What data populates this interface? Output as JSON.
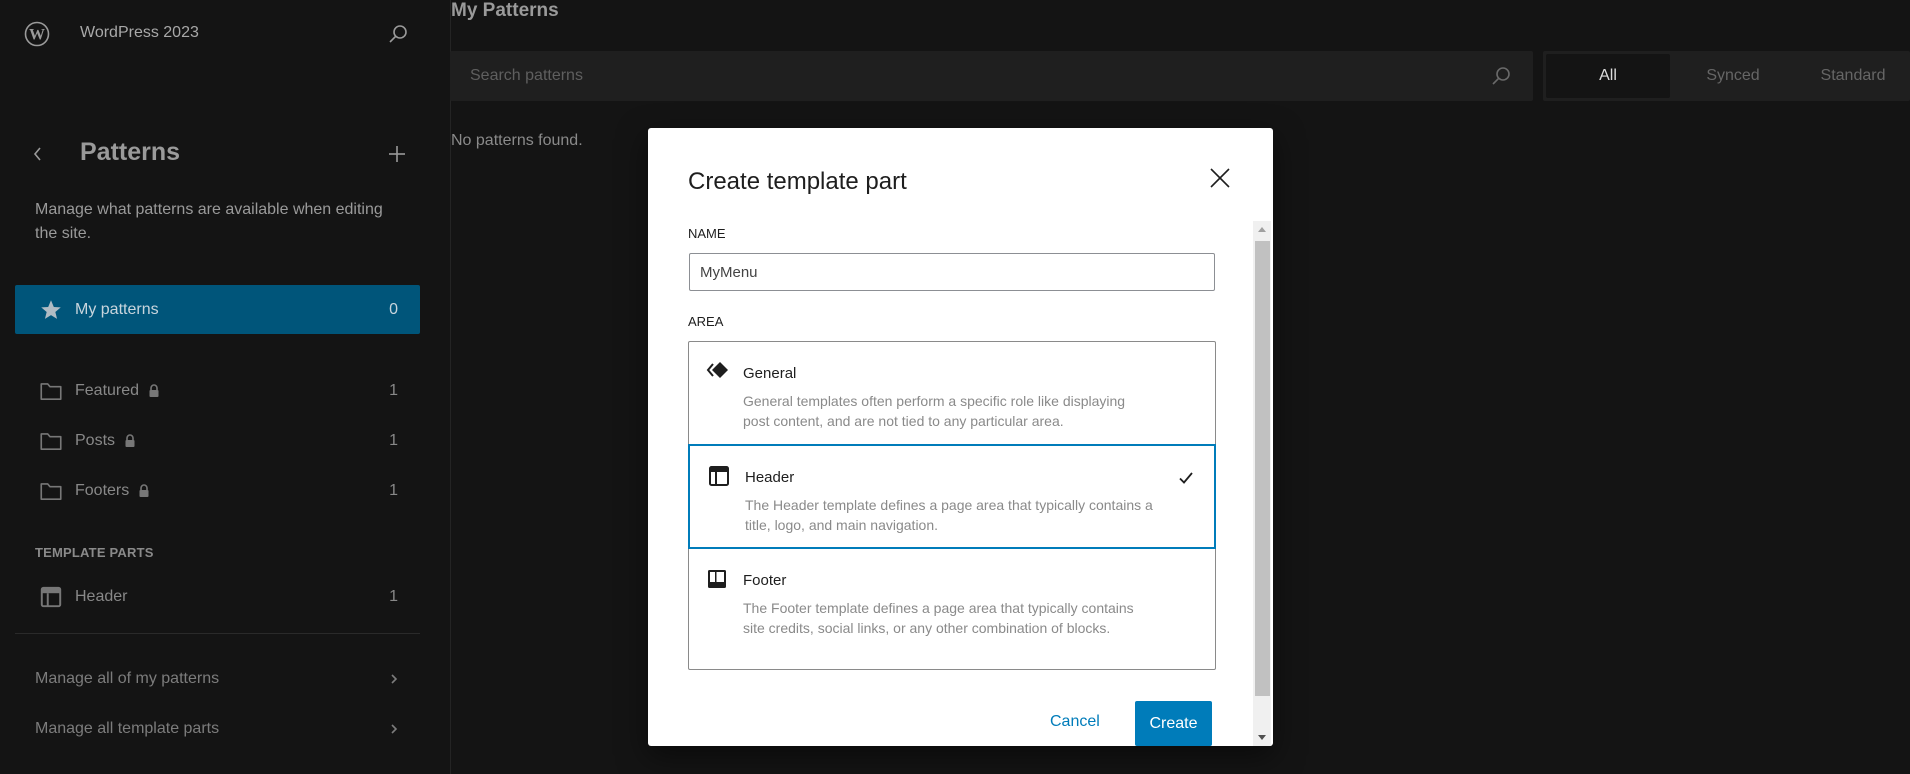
{
  "site": {
    "title": "WordPress 2023"
  },
  "sidebar": {
    "title": "Patterns",
    "description": "Manage what patterns are available when editing the site.",
    "items": [
      {
        "label": "My patterns",
        "count": "0",
        "icon": "star-icon",
        "active": true
      },
      {
        "label": "Featured",
        "count": "1",
        "icon": "folder-icon",
        "locked": true
      },
      {
        "label": "Posts",
        "count": "1",
        "icon": "folder-icon",
        "locked": true
      },
      {
        "label": "Footers",
        "count": "1",
        "icon": "folder-icon",
        "locked": true
      }
    ],
    "template_parts_heading": "TEMPLATE PARTS",
    "template_parts": [
      {
        "label": "Header",
        "count": "1",
        "icon": "header-layout-icon"
      }
    ],
    "links": [
      {
        "label": "Manage all of my patterns"
      },
      {
        "label": "Manage all template parts"
      }
    ]
  },
  "main": {
    "title": "My Patterns",
    "search_placeholder": "Search patterns",
    "filters": [
      {
        "label": "All",
        "active": true
      },
      {
        "label": "Synced"
      },
      {
        "label": "Standard"
      }
    ],
    "empty_message": "No patterns found."
  },
  "modal": {
    "title": "Create template part",
    "name_label": "NAME",
    "name_value": "MyMenu",
    "area_label": "AREA",
    "areas": [
      {
        "name": "General",
        "description": "General templates often perform a specific role like displaying post content, and are not tied to any particular area.",
        "selected": false
      },
      {
        "name": "Header",
        "description": "The Header template defines a page area that typically contains a title, logo, and main navigation.",
        "selected": true
      },
      {
        "name": "Footer",
        "description": "The Footer template defines a page area that typically contains site credits, social links, or any other combination of blocks.",
        "selected": false
      }
    ],
    "cancel_label": "Cancel",
    "create_label": "Create"
  },
  "colors": {
    "accent": "#007cba",
    "active_nav": "#00557a",
    "background": "#141414"
  }
}
